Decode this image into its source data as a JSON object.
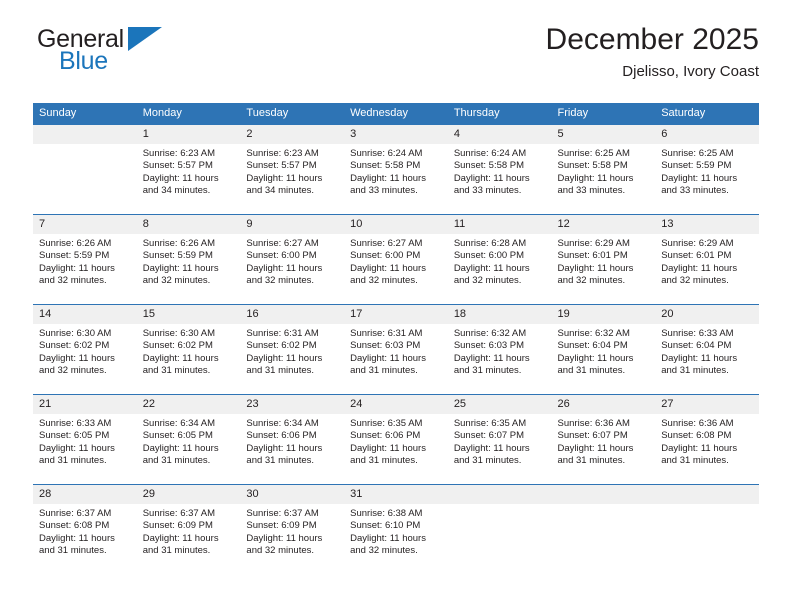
{
  "brand": {
    "name_part1": "General",
    "name_part2": "Blue",
    "triangle_icon": "blue-triangle-icon",
    "colors": {
      "dark": "#231f20",
      "blue": "#1b75bb"
    }
  },
  "header": {
    "title": "December 2025",
    "subtitle": "Djelisso, Ivory Coast"
  },
  "theme": {
    "header_bg": "#2e74b5",
    "header_text": "#ffffff",
    "daynum_bg": "#f0f0f0",
    "row_border": "#2e74b5",
    "body_text": "#231f20"
  },
  "weekday_headers": [
    "Sunday",
    "Monday",
    "Tuesday",
    "Wednesday",
    "Thursday",
    "Friday",
    "Saturday"
  ],
  "weeks": [
    [
      {
        "day": "",
        "sunrise": "",
        "sunset": "",
        "daylight_line1": "",
        "daylight_line2": "",
        "empty": true
      },
      {
        "day": "1",
        "sunrise": "Sunrise: 6:23 AM",
        "sunset": "Sunset: 5:57 PM",
        "daylight_line1": "Daylight: 11 hours",
        "daylight_line2": "and 34 minutes."
      },
      {
        "day": "2",
        "sunrise": "Sunrise: 6:23 AM",
        "sunset": "Sunset: 5:57 PM",
        "daylight_line1": "Daylight: 11 hours",
        "daylight_line2": "and 34 minutes."
      },
      {
        "day": "3",
        "sunrise": "Sunrise: 6:24 AM",
        "sunset": "Sunset: 5:58 PM",
        "daylight_line1": "Daylight: 11 hours",
        "daylight_line2": "and 33 minutes."
      },
      {
        "day": "4",
        "sunrise": "Sunrise: 6:24 AM",
        "sunset": "Sunset: 5:58 PM",
        "daylight_line1": "Daylight: 11 hours",
        "daylight_line2": "and 33 minutes."
      },
      {
        "day": "5",
        "sunrise": "Sunrise: 6:25 AM",
        "sunset": "Sunset: 5:58 PM",
        "daylight_line1": "Daylight: 11 hours",
        "daylight_line2": "and 33 minutes."
      },
      {
        "day": "6",
        "sunrise": "Sunrise: 6:25 AM",
        "sunset": "Sunset: 5:59 PM",
        "daylight_line1": "Daylight: 11 hours",
        "daylight_line2": "and 33 minutes."
      }
    ],
    [
      {
        "day": "7",
        "sunrise": "Sunrise: 6:26 AM",
        "sunset": "Sunset: 5:59 PM",
        "daylight_line1": "Daylight: 11 hours",
        "daylight_line2": "and 32 minutes."
      },
      {
        "day": "8",
        "sunrise": "Sunrise: 6:26 AM",
        "sunset": "Sunset: 5:59 PM",
        "daylight_line1": "Daylight: 11 hours",
        "daylight_line2": "and 32 minutes."
      },
      {
        "day": "9",
        "sunrise": "Sunrise: 6:27 AM",
        "sunset": "Sunset: 6:00 PM",
        "daylight_line1": "Daylight: 11 hours",
        "daylight_line2": "and 32 minutes."
      },
      {
        "day": "10",
        "sunrise": "Sunrise: 6:27 AM",
        "sunset": "Sunset: 6:00 PM",
        "daylight_line1": "Daylight: 11 hours",
        "daylight_line2": "and 32 minutes."
      },
      {
        "day": "11",
        "sunrise": "Sunrise: 6:28 AM",
        "sunset": "Sunset: 6:00 PM",
        "daylight_line1": "Daylight: 11 hours",
        "daylight_line2": "and 32 minutes."
      },
      {
        "day": "12",
        "sunrise": "Sunrise: 6:29 AM",
        "sunset": "Sunset: 6:01 PM",
        "daylight_line1": "Daylight: 11 hours",
        "daylight_line2": "and 32 minutes."
      },
      {
        "day": "13",
        "sunrise": "Sunrise: 6:29 AM",
        "sunset": "Sunset: 6:01 PM",
        "daylight_line1": "Daylight: 11 hours",
        "daylight_line2": "and 32 minutes."
      }
    ],
    [
      {
        "day": "14",
        "sunrise": "Sunrise: 6:30 AM",
        "sunset": "Sunset: 6:02 PM",
        "daylight_line1": "Daylight: 11 hours",
        "daylight_line2": "and 32 minutes."
      },
      {
        "day": "15",
        "sunrise": "Sunrise: 6:30 AM",
        "sunset": "Sunset: 6:02 PM",
        "daylight_line1": "Daylight: 11 hours",
        "daylight_line2": "and 31 minutes."
      },
      {
        "day": "16",
        "sunrise": "Sunrise: 6:31 AM",
        "sunset": "Sunset: 6:02 PM",
        "daylight_line1": "Daylight: 11 hours",
        "daylight_line2": "and 31 minutes."
      },
      {
        "day": "17",
        "sunrise": "Sunrise: 6:31 AM",
        "sunset": "Sunset: 6:03 PM",
        "daylight_line1": "Daylight: 11 hours",
        "daylight_line2": "and 31 minutes."
      },
      {
        "day": "18",
        "sunrise": "Sunrise: 6:32 AM",
        "sunset": "Sunset: 6:03 PM",
        "daylight_line1": "Daylight: 11 hours",
        "daylight_line2": "and 31 minutes."
      },
      {
        "day": "19",
        "sunrise": "Sunrise: 6:32 AM",
        "sunset": "Sunset: 6:04 PM",
        "daylight_line1": "Daylight: 11 hours",
        "daylight_line2": "and 31 minutes."
      },
      {
        "day": "20",
        "sunrise": "Sunrise: 6:33 AM",
        "sunset": "Sunset: 6:04 PM",
        "daylight_line1": "Daylight: 11 hours",
        "daylight_line2": "and 31 minutes."
      }
    ],
    [
      {
        "day": "21",
        "sunrise": "Sunrise: 6:33 AM",
        "sunset": "Sunset: 6:05 PM",
        "daylight_line1": "Daylight: 11 hours",
        "daylight_line2": "and 31 minutes."
      },
      {
        "day": "22",
        "sunrise": "Sunrise: 6:34 AM",
        "sunset": "Sunset: 6:05 PM",
        "daylight_line1": "Daylight: 11 hours",
        "daylight_line2": "and 31 minutes."
      },
      {
        "day": "23",
        "sunrise": "Sunrise: 6:34 AM",
        "sunset": "Sunset: 6:06 PM",
        "daylight_line1": "Daylight: 11 hours",
        "daylight_line2": "and 31 minutes."
      },
      {
        "day": "24",
        "sunrise": "Sunrise: 6:35 AM",
        "sunset": "Sunset: 6:06 PM",
        "daylight_line1": "Daylight: 11 hours",
        "daylight_line2": "and 31 minutes."
      },
      {
        "day": "25",
        "sunrise": "Sunrise: 6:35 AM",
        "sunset": "Sunset: 6:07 PM",
        "daylight_line1": "Daylight: 11 hours",
        "daylight_line2": "and 31 minutes."
      },
      {
        "day": "26",
        "sunrise": "Sunrise: 6:36 AM",
        "sunset": "Sunset: 6:07 PM",
        "daylight_line1": "Daylight: 11 hours",
        "daylight_line2": "and 31 minutes."
      },
      {
        "day": "27",
        "sunrise": "Sunrise: 6:36 AM",
        "sunset": "Sunset: 6:08 PM",
        "daylight_line1": "Daylight: 11 hours",
        "daylight_line2": "and 31 minutes."
      }
    ],
    [
      {
        "day": "28",
        "sunrise": "Sunrise: 6:37 AM",
        "sunset": "Sunset: 6:08 PM",
        "daylight_line1": "Daylight: 11 hours",
        "daylight_line2": "and 31 minutes."
      },
      {
        "day": "29",
        "sunrise": "Sunrise: 6:37 AM",
        "sunset": "Sunset: 6:09 PM",
        "daylight_line1": "Daylight: 11 hours",
        "daylight_line2": "and 31 minutes."
      },
      {
        "day": "30",
        "sunrise": "Sunrise: 6:37 AM",
        "sunset": "Sunset: 6:09 PM",
        "daylight_line1": "Daylight: 11 hours",
        "daylight_line2": "and 32 minutes."
      },
      {
        "day": "31",
        "sunrise": "Sunrise: 6:38 AM",
        "sunset": "Sunset: 6:10 PM",
        "daylight_line1": "Daylight: 11 hours",
        "daylight_line2": "and 32 minutes."
      },
      {
        "day": "",
        "sunrise": "",
        "sunset": "",
        "daylight_line1": "",
        "daylight_line2": "",
        "empty": true
      },
      {
        "day": "",
        "sunrise": "",
        "sunset": "",
        "daylight_line1": "",
        "daylight_line2": "",
        "empty": true
      },
      {
        "day": "",
        "sunrise": "",
        "sunset": "",
        "daylight_line1": "",
        "daylight_line2": "",
        "empty": true
      }
    ]
  ]
}
